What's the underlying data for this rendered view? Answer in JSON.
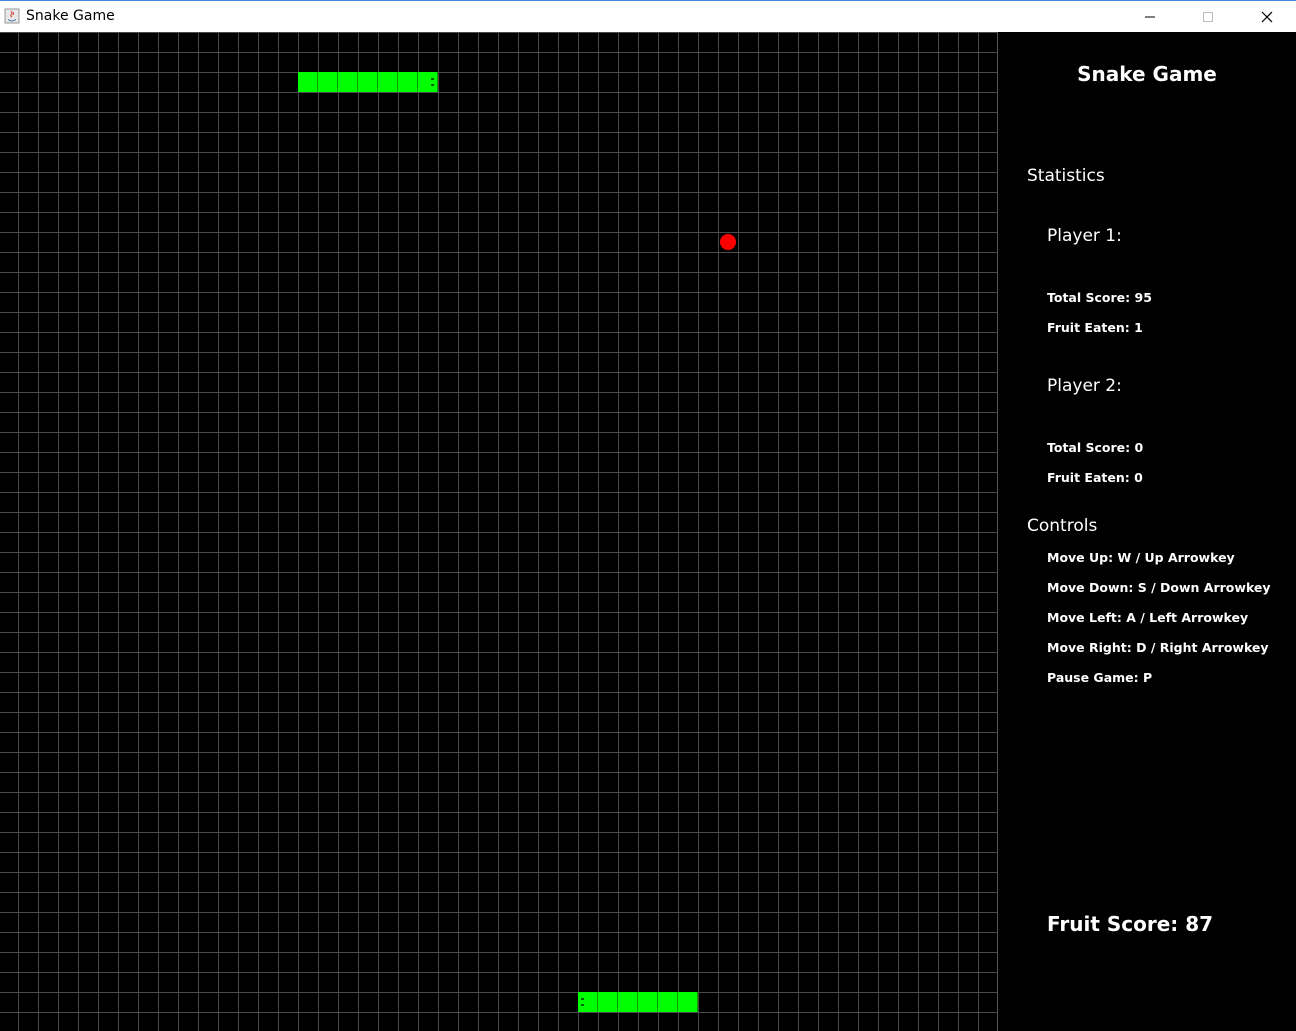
{
  "window": {
    "title": "Snake Game",
    "app_icon": "java-icon",
    "controls": [
      "minimize-icon",
      "maximize-icon",
      "close-icon"
    ]
  },
  "colors": {
    "background": "#000000",
    "grid": "#4a4a4a",
    "snake": "#00ff00",
    "fruit": "#ff0000",
    "text": "#ffffff"
  },
  "sidebar": {
    "title": "Snake Game",
    "statistics_heading": "Statistics",
    "player1": {
      "heading": "Player 1:",
      "total_score": "Total Score: 95",
      "fruit_eaten": "Fruit Eaten: 1"
    },
    "player2": {
      "heading": "Player 2:",
      "total_score": "Total Score: 0",
      "fruit_eaten": "Fruit Eaten: 0"
    },
    "controls_heading": "Controls",
    "controls": {
      "up": "Move Up: W / Up Arrowkey",
      "down": "Move Down: S / Down Arrowkey",
      "left": "Move Left: A / Left Arrowkey",
      "right": "Move Right: D / Right Arrowkey",
      "pause": "Pause Game: P"
    },
    "fruit_score": "Fruit Score: 87"
  }
}
